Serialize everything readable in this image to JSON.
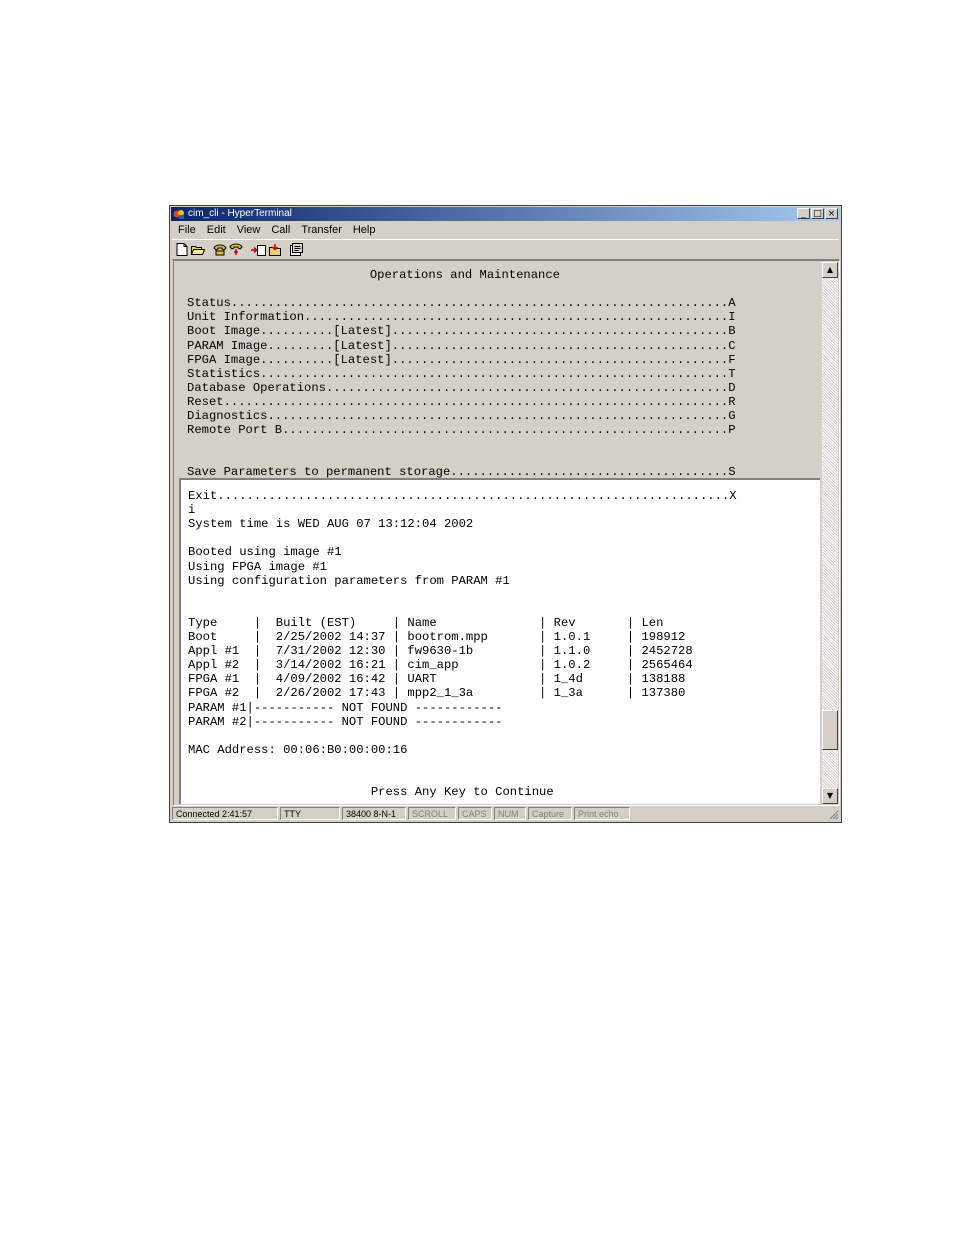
{
  "window": {
    "title": "cim_cli - HyperTerminal",
    "controls": {
      "minimize": "_",
      "maximize": "□",
      "close": "×"
    }
  },
  "menu": [
    "File",
    "Edit",
    "View",
    "Call",
    "Transfer",
    "Help"
  ],
  "toolbar": {
    "buttons": [
      "new-icon",
      "open-icon",
      "connect-icon",
      "disconnect-icon",
      "send-icon",
      "receive-icon",
      "properties-icon"
    ]
  },
  "terminal": {
    "menu_screen": [
      "                         Operations and Maintenance",
      "",
      "Status....................................................................A",
      "Unit Information..........................................................I",
      "Boot Image..........[Latest]..............................................B",
      "PARAM Image.........[Latest]..............................................C",
      "FPGA Image..........[Latest]..............................................F",
      "Statistics................................................................T",
      "Database Operations.......................................................D",
      "Reset.....................................................................R",
      "Diagnostics...............................................................G",
      "Remote Port B.............................................................P",
      "",
      "",
      "Save Parameters to permanent storage......................................S"
    ],
    "output_screen": [
      "Exit......................................................................X",
      "i",
      "System time is WED AUG 07 13:12:04 2002",
      "",
      "Booted using image #1",
      "Using FPGA image #1",
      "Using configuration parameters from PARAM #1",
      "",
      "",
      "Type     |  Built (EST)     | Name              | Rev       | Len",
      "Boot     |  2/25/2002 14:37 | bootrom.mpp       | 1.0.1     | 198912",
      "Appl #1  |  7/31/2002 12:30 | fw9630-1b         | 1.1.0     | 2452728",
      "Appl #2  |  3/14/2002 16:21 | cim_app           | 1.0.2     | 2565464",
      "FPGA #1  |  4/09/2002 16:42 | UART              | 1_4d      | 138188",
      "FPGA #2  |  2/26/2002 17:43 | mpp2_1_3a         | 1_3a      | 137380",
      "PARAM #1|----------- NOT FOUND ------------",
      "PARAM #2|----------- NOT FOUND ------------",
      "",
      "MAC Address: 00:06:B0:00:00:16",
      "",
      "",
      "                         Press Any Key to Continue"
    ]
  },
  "scrollbar": {
    "up": "▲",
    "down": "▼",
    "position_fraction": 0.92
  },
  "statusbar": [
    {
      "text": "Connected 2:41:57",
      "active": true,
      "name": "status-connected"
    },
    {
      "text": "TTY",
      "active": true,
      "name": "status-emulation"
    },
    {
      "text": "38400 8-N-1",
      "active": true,
      "name": "status-port-settings"
    },
    {
      "text": "SCROLL",
      "active": false,
      "name": "status-scroll"
    },
    {
      "text": "CAPS",
      "active": false,
      "name": "status-caps"
    },
    {
      "text": "NUM",
      "active": false,
      "name": "status-num"
    },
    {
      "text": "Capture",
      "active": false,
      "name": "status-capture"
    },
    {
      "text": "Print echo",
      "active": false,
      "name": "status-print-echo"
    }
  ],
  "colors": {
    "titlebar_start": "#0a246a",
    "titlebar_end": "#a6caf0",
    "chrome": "#d4d0c8",
    "terminal_text": "#000000"
  }
}
